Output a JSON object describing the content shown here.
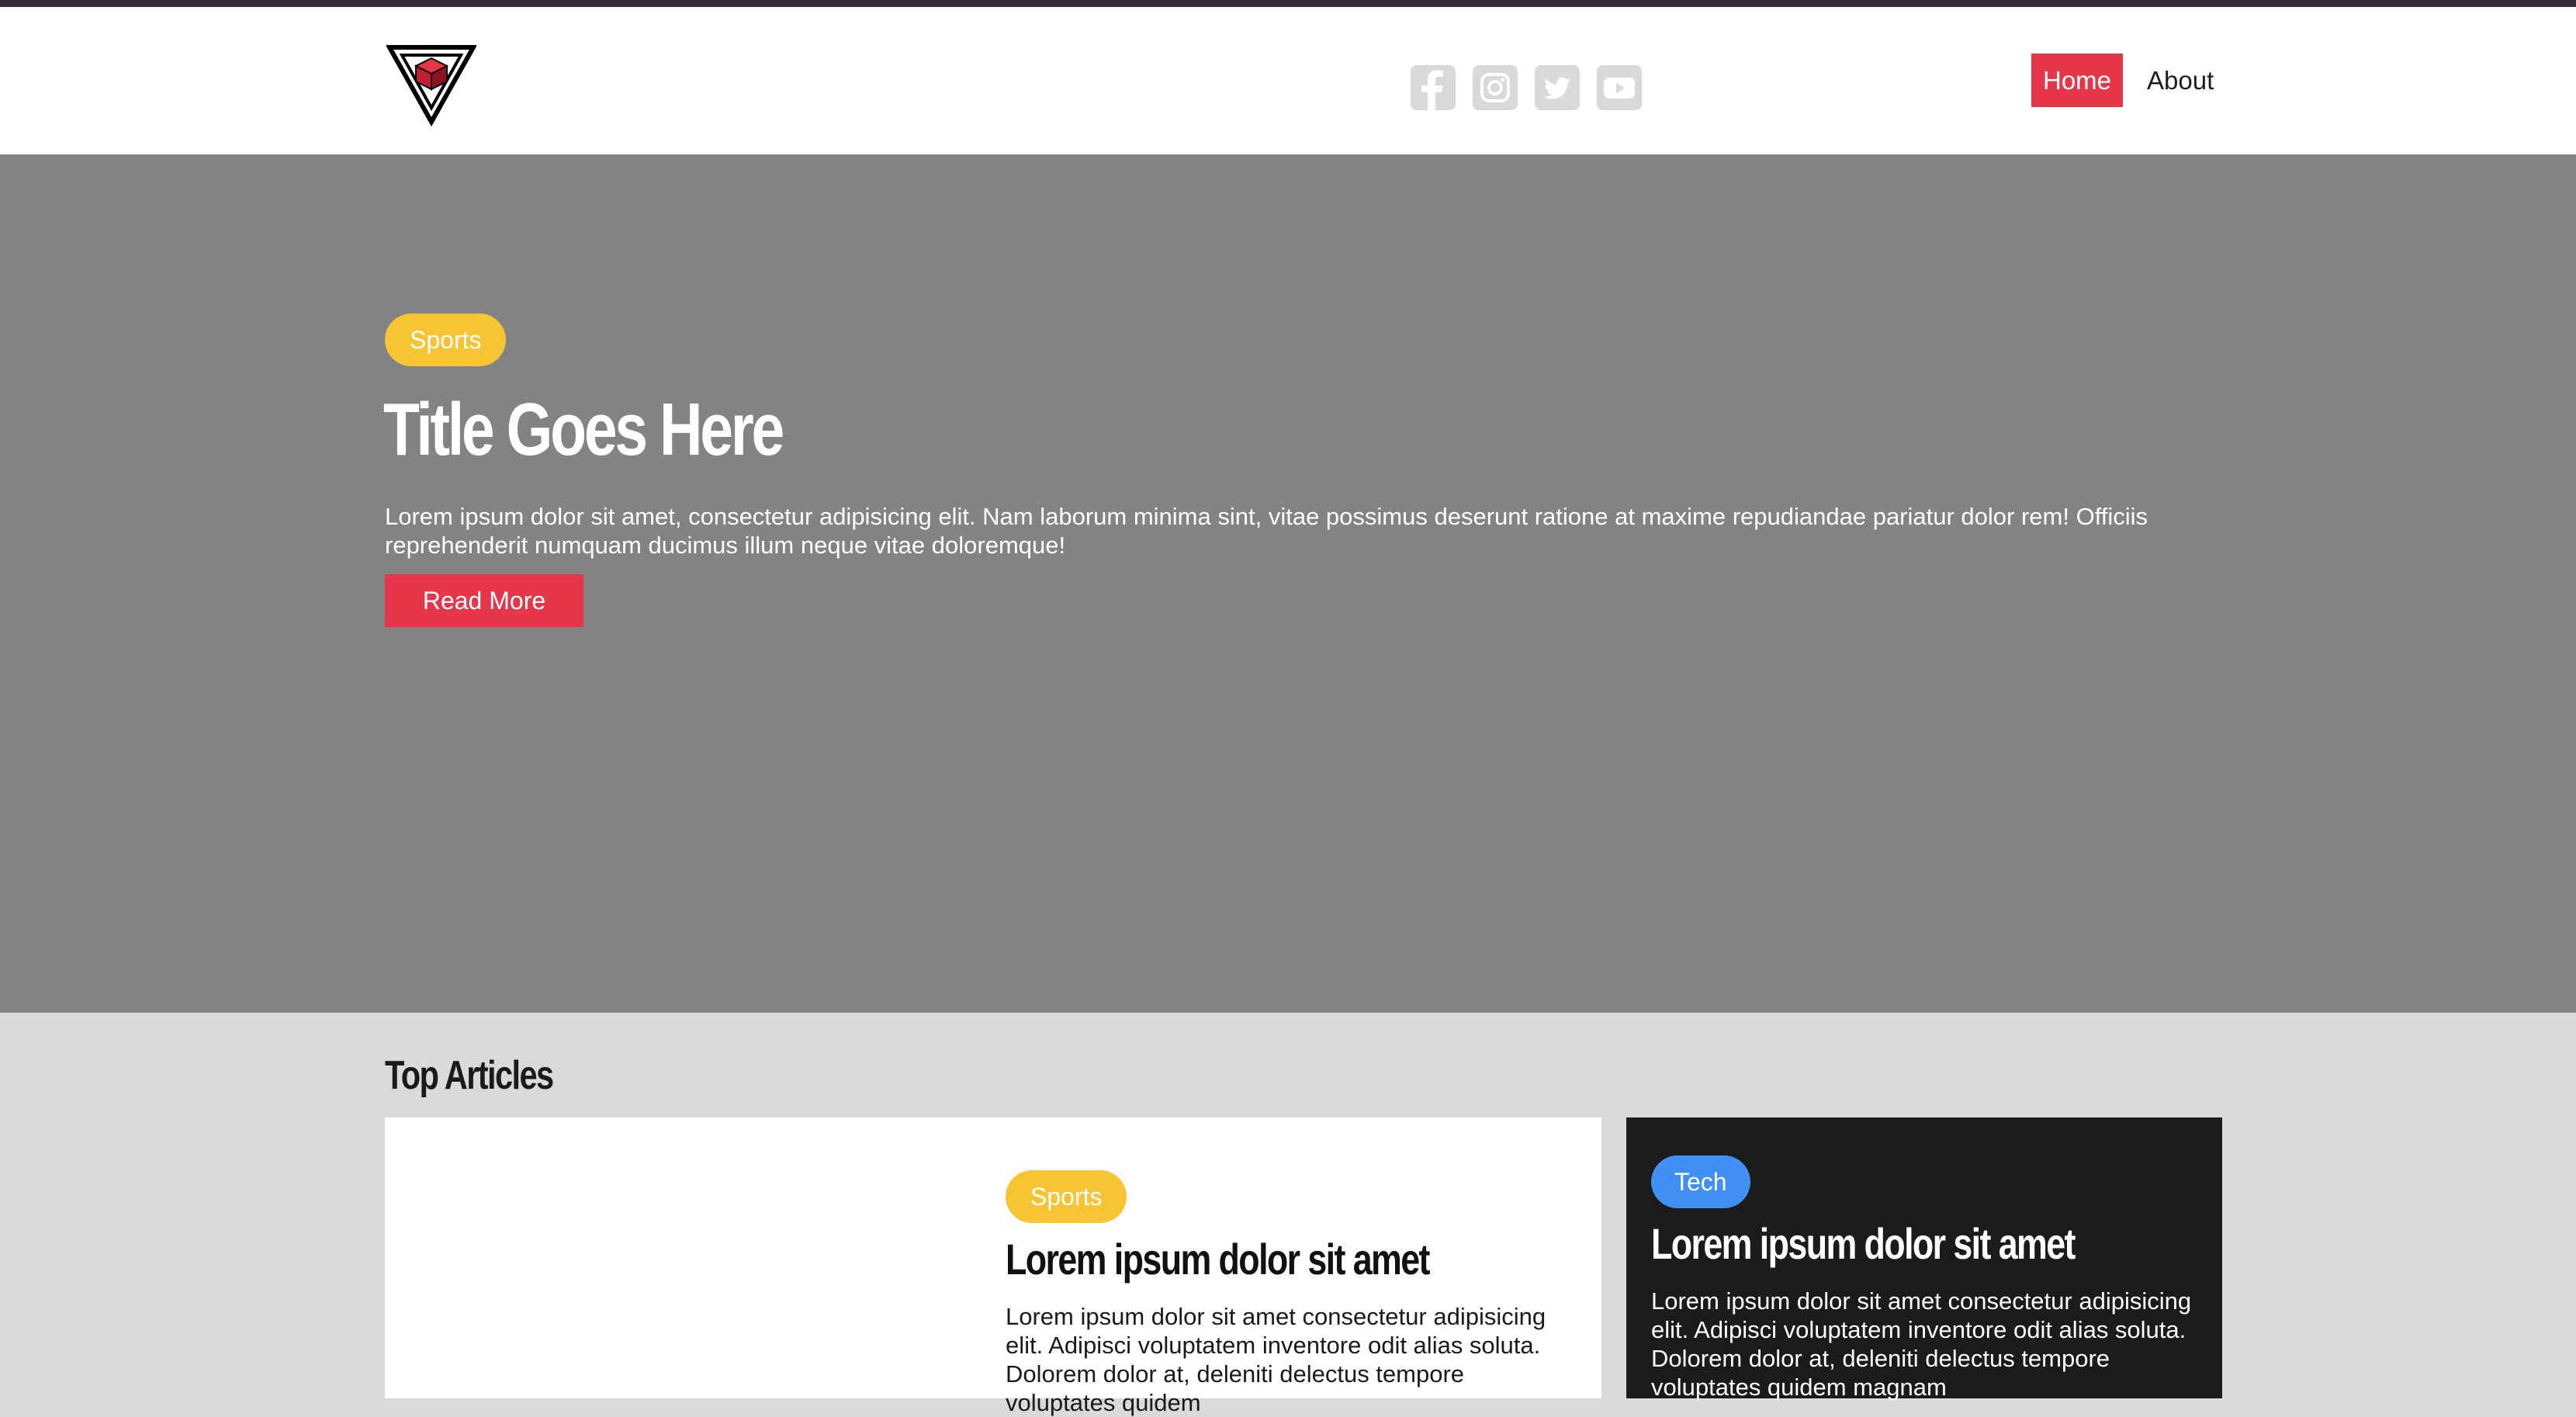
{
  "header": {
    "logo_icon": "triangle-cube-logo-icon",
    "social": [
      {
        "icon": "facebook-icon"
      },
      {
        "icon": "instagram-icon"
      },
      {
        "icon": "twitter-icon"
      },
      {
        "icon": "youtube-icon"
      }
    ],
    "nav": [
      {
        "label": "Home",
        "active": true
      },
      {
        "label": "About",
        "active": false
      }
    ]
  },
  "hero": {
    "badge": "Sports",
    "title": "Title Goes Here",
    "text": "Lorem ipsum dolor sit amet, consectetur adipisicing elit. Nam laborum minima sint, vitae possimus deserunt ratione at maxime repudiandae pariatur dolor rem! Officiis reprehenderit numquam ducimus illum neque vitae doloremque!",
    "button": "Read More"
  },
  "top_articles": {
    "heading": "Top Articles",
    "main_card": {
      "badge": "Sports",
      "title": "Lorem ipsum dolor sit amet",
      "text": "Lorem ipsum dolor sit amet consectetur adipisicing elit. Adipisci voluptatem inventore odit alias soluta. Dolorem dolor at, deleniti delectus tempore voluptates quidem"
    },
    "side_card": {
      "badge": "Tech",
      "title": "Lorem ipsum dolor sit amet",
      "text": "Lorem ipsum dolor sit amet consectetur adipisicing elit. Adipisci voluptatem inventore odit alias soluta. Dolorem dolor at, deleniti delectus tempore voluptates quidem magnam"
    }
  },
  "colors": {
    "accent_red": "#e7354a",
    "sports_yellow": "#f7c433",
    "tech_blue": "#3f8ff4",
    "hero_gray": "#838383",
    "page_bg": "#dadada",
    "dark_card": "#1b1b1b"
  }
}
